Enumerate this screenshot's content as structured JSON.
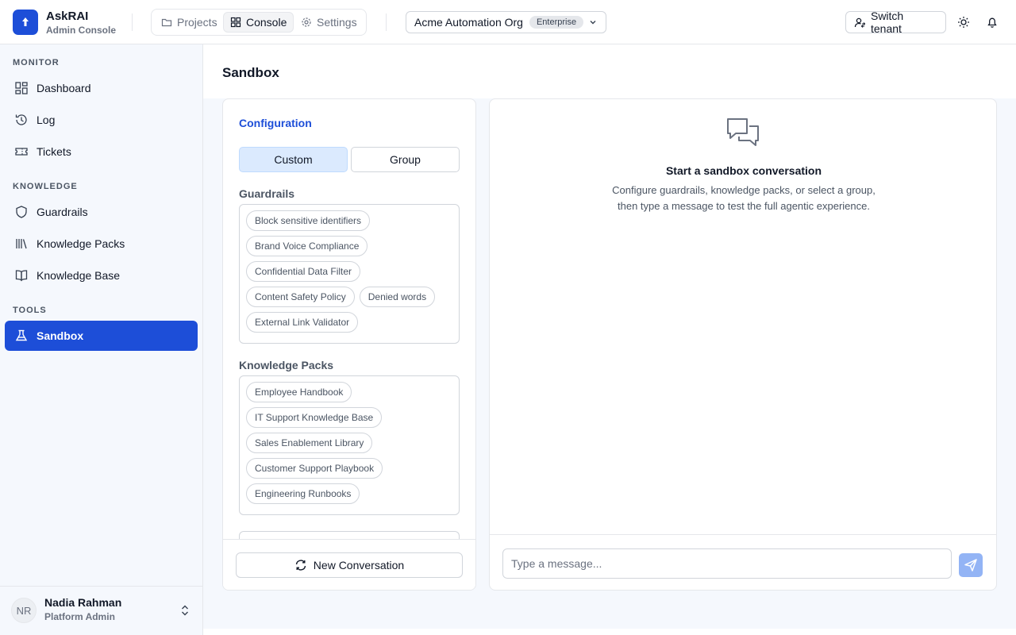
{
  "brand": {
    "name": "AskRAI",
    "subtitle": "Admin Console"
  },
  "topnav": {
    "items": [
      {
        "label": "Projects",
        "icon": "folder-icon"
      },
      {
        "label": "Console",
        "icon": "grid-icon",
        "active": true
      },
      {
        "label": "Settings",
        "icon": "gear-icon"
      }
    ]
  },
  "org": {
    "name": "Acme Automation Org",
    "plan": "Enterprise"
  },
  "header_actions": {
    "switch_tenant": "Switch tenant"
  },
  "sidebar": {
    "sections": [
      {
        "label": "MONITOR",
        "items": [
          {
            "label": "Dashboard",
            "icon": "dashboard-icon"
          },
          {
            "label": "Log",
            "icon": "history-icon"
          },
          {
            "label": "Tickets",
            "icon": "ticket-icon"
          }
        ]
      },
      {
        "label": "KNOWLEDGE",
        "items": [
          {
            "label": "Guardrails",
            "icon": "shield-icon"
          },
          {
            "label": "Knowledge Packs",
            "icon": "library-icon"
          },
          {
            "label": "Knowledge Base",
            "icon": "book-icon"
          }
        ]
      },
      {
        "label": "TOOLS",
        "items": [
          {
            "label": "Sandbox",
            "icon": "flask-icon",
            "active": true
          }
        ]
      }
    ]
  },
  "user": {
    "initials": "NR",
    "name": "Nadia Rahman",
    "role": "Platform Admin"
  },
  "page": {
    "title": "Sandbox"
  },
  "config": {
    "title": "Configuration",
    "mode_options": [
      "Custom",
      "Group"
    ],
    "selected_mode": "Custom",
    "guardrails": {
      "title": "Guardrails",
      "chips": [
        "Block sensitive identifiers",
        "Brand Voice Compliance",
        "Confidential Data Filter",
        "Content Safety Policy",
        "Denied words",
        "External Link Validator"
      ]
    },
    "knowledge_packs": {
      "title": "Knowledge Packs",
      "chips": [
        "Employee Handbook",
        "IT Support Knowledge Base",
        "Sales Enablement Library",
        "Customer Support Playbook",
        "Engineering Runbooks"
      ]
    },
    "new_conversation": "New Conversation"
  },
  "chat": {
    "empty_title": "Start a sandbox conversation",
    "empty_desc_line1": "Configure guardrails, knowledge packs, or select a group,",
    "empty_desc_line2": "then type a message to test the full agentic experience.",
    "input_placeholder": "Type a message..."
  },
  "colors": {
    "accent": "#1d4ed8",
    "sidebar_bg": "#f5f8fd",
    "send_disabled": "#93b4f5"
  }
}
